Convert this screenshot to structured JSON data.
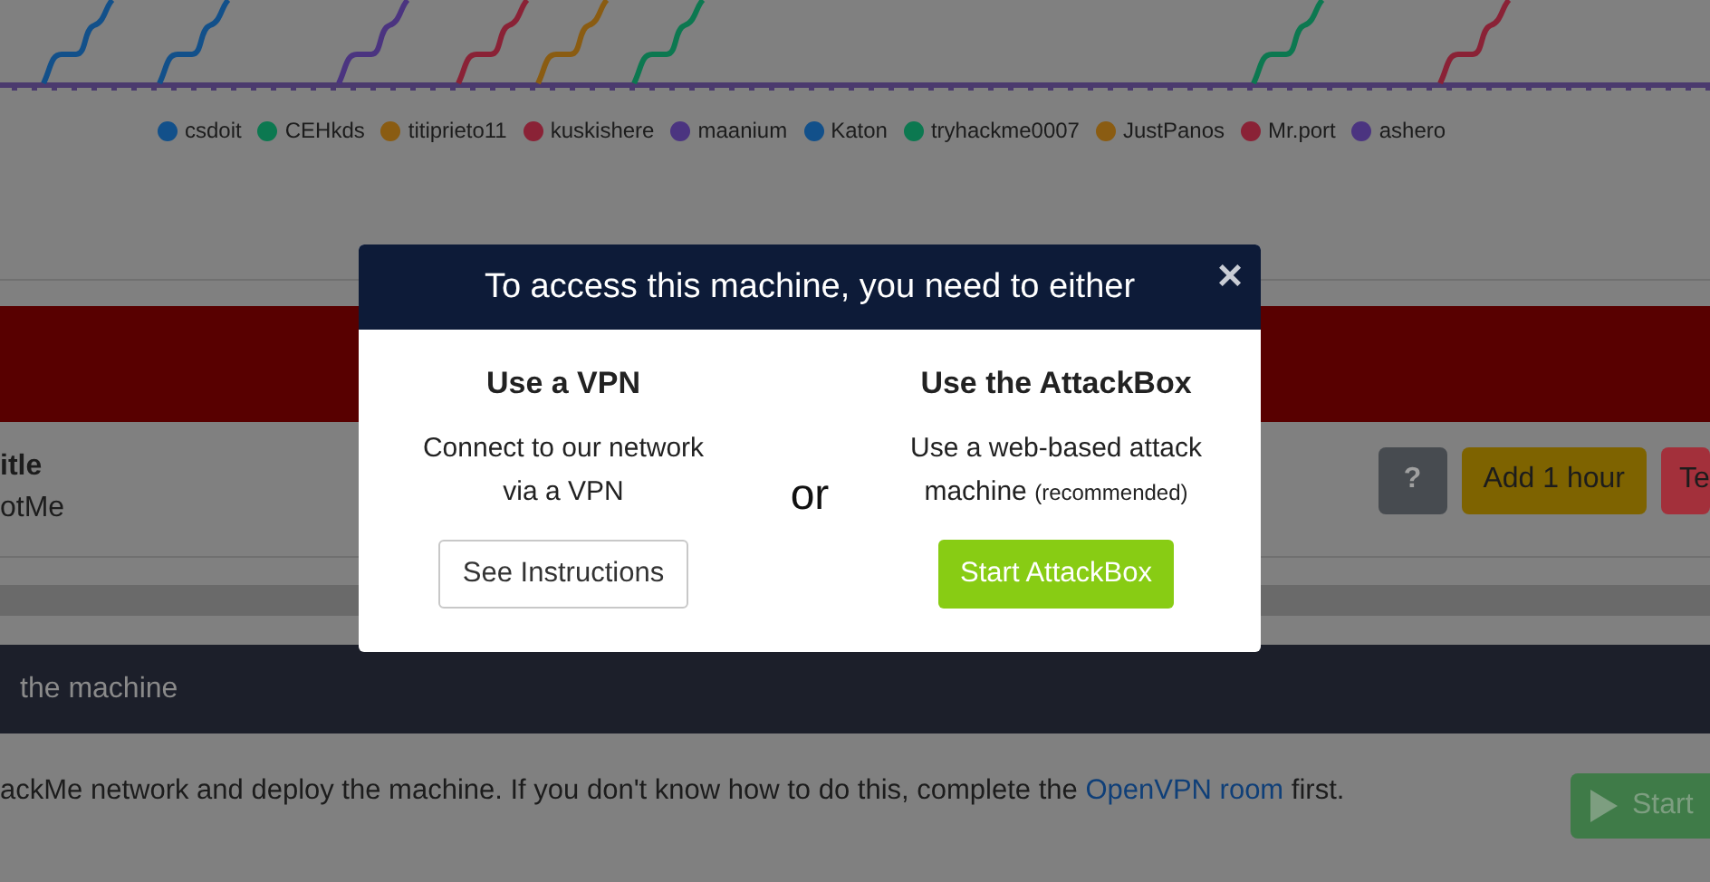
{
  "legend": [
    {
      "label": "csdoit",
      "color": "#12508a"
    },
    {
      "label": "CEHkds",
      "color": "#0c7850"
    },
    {
      "label": "titiprieto11",
      "color": "#8a5c12"
    },
    {
      "label": "kuskishere",
      "color": "#8a2236"
    },
    {
      "label": "maanium",
      "color": "#4b3480"
    },
    {
      "label": "Katon",
      "color": "#12508a"
    },
    {
      "label": "tryhackme0007",
      "color": "#0c7850"
    },
    {
      "label": "JustPanos",
      "color": "#8a5c12"
    },
    {
      "label": "Mr.port",
      "color": "#8a2236"
    },
    {
      "label": "ashero",
      "color": "#4b3480"
    }
  ],
  "machine": {
    "label": "itle",
    "value": "otMe"
  },
  "actions": [
    {
      "kind": "help",
      "label": "?"
    },
    {
      "kind": "extend",
      "label": "Add 1 hour"
    },
    {
      "kind": "terminate",
      "label": "Te"
    }
  ],
  "task": {
    "title": "the machine",
    "text_before": "ackMe network and deploy the machine. If you don't know how to do this, complete the ",
    "link": "OpenVPN room",
    "text_after": " first.",
    "button": "Start"
  },
  "modal": {
    "title": "To access this machine, you need to either",
    "close": "×",
    "separator": "or",
    "options": [
      {
        "kind": "vpn",
        "heading": "Use a VPN",
        "text": "Connect to our network via a VPN",
        "button": "See Instructions"
      },
      {
        "kind": "attackbox",
        "heading": "Use the AttackBox",
        "text": "Use a web-based attack machine",
        "note": "(recommended)",
        "button": "Start AttackBox"
      }
    ]
  }
}
